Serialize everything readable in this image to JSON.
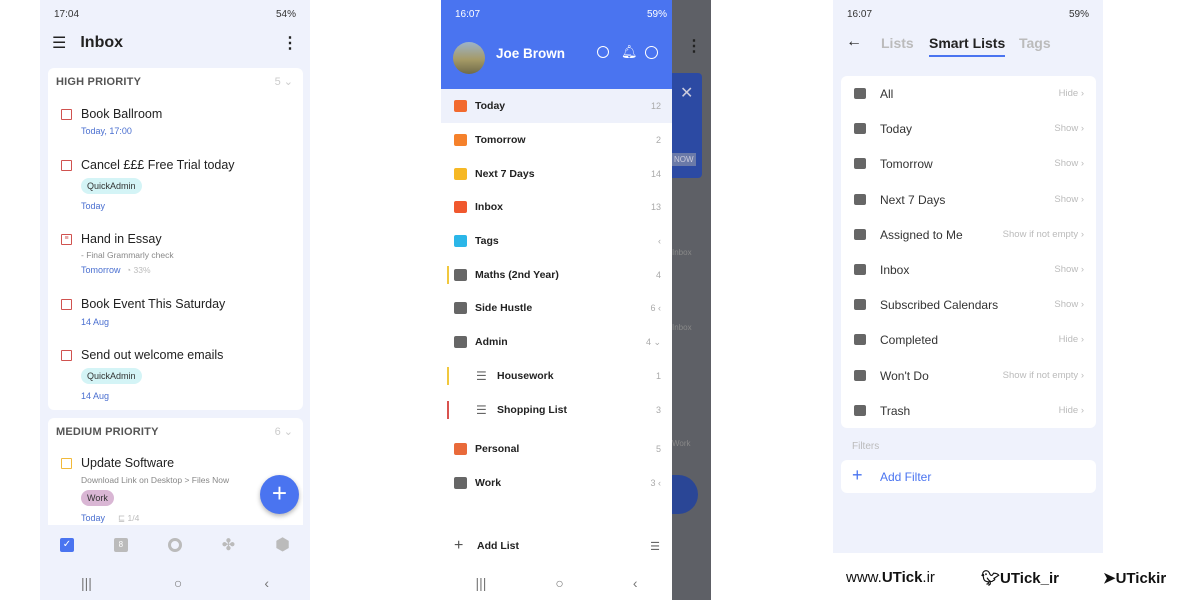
{
  "screen1": {
    "status": {
      "time": "17:04",
      "battery": "54%"
    },
    "title": "Inbox",
    "sections": [
      {
        "name": "HIGH PRIORITY",
        "count": "5",
        "tasks": [
          {
            "title": "Book Ballroom",
            "date": "Today, 17:00"
          },
          {
            "title": "Cancel £££ Free Trial today",
            "tag": "QuickAdmin",
            "date": "Today"
          },
          {
            "title": "Hand in Essay",
            "subtitle": "- Final Grammarly check",
            "date": "Tomorrow",
            "progress": "33%"
          },
          {
            "title": "Book Event This Saturday",
            "date": "14 Aug"
          },
          {
            "title": "Send out welcome emails",
            "tag": "QuickAdmin",
            "date": "14 Aug"
          }
        ]
      },
      {
        "name": "MEDIUM PRIORITY",
        "count": "6",
        "tasks": [
          {
            "title": "Update Software",
            "subtitle": "Download Link on Desktop > Files Now",
            "tag": "Work",
            "date": "Today",
            "subtasks": "1/4"
          }
        ]
      }
    ],
    "fab": "+",
    "nav": [
      "tasks-icon",
      "calendar-icon",
      "search-icon",
      "apps-icon",
      "settings-icon"
    ],
    "calendar_day": "8"
  },
  "screen2": {
    "status": {
      "time": "16:07",
      "battery": "59%"
    },
    "user": "Joe Brown",
    "items": [
      {
        "label": "Today",
        "count": "12",
        "color": "#f26a2e"
      },
      {
        "label": "Tomorrow",
        "count": "2",
        "color": "#f5812b"
      },
      {
        "label": "Next 7 Days",
        "count": "14",
        "color": "#f6b825"
      },
      {
        "label": "Inbox",
        "count": "13",
        "color": "#f0582e"
      },
      {
        "label": "Tags",
        "count": "",
        "color": "#2bb6e8"
      },
      {
        "label": "Maths (2nd Year)",
        "count": "4",
        "color": "#666",
        "bar": "#f1c83d"
      },
      {
        "label": "Side Hustle",
        "count": "6",
        "color": "#666"
      },
      {
        "label": "Admin",
        "count": "4",
        "color": "#666"
      },
      {
        "label": "Housework",
        "count": "1",
        "color": "#666",
        "bar": "#f1c83d",
        "indent": true
      },
      {
        "label": "Shopping List",
        "count": "3",
        "color": "#666",
        "bar": "#d9534f",
        "indent": true
      },
      {
        "label": "Personal",
        "count": "5",
        "color": "#e96a3a"
      },
      {
        "label": "Work",
        "count": "3",
        "color": "#666"
      }
    ],
    "add_list": "Add List",
    "behind": {
      "now": "NOW",
      "inbox": "Inbox",
      "work": "Work"
    }
  },
  "screen3": {
    "status": {
      "time": "16:07",
      "battery": "59%"
    },
    "tabs": [
      "Lists",
      "Smart Lists",
      "Tags"
    ],
    "active_tab": "Smart Lists",
    "rows": [
      {
        "label": "All",
        "value": "Hide"
      },
      {
        "label": "Today",
        "value": "Show"
      },
      {
        "label": "Tomorrow",
        "value": "Show"
      },
      {
        "label": "Next 7 Days",
        "value": "Show"
      },
      {
        "label": "Assigned to Me",
        "value": "Show if not empty"
      },
      {
        "label": "Inbox",
        "value": "Show"
      },
      {
        "label": "Subscribed Calendars",
        "value": "Show"
      },
      {
        "label": "Completed",
        "value": "Hide"
      },
      {
        "label": "Won't Do",
        "value": "Show if not empty"
      },
      {
        "label": "Trash",
        "value": "Hide"
      }
    ],
    "filters_label": "Filters",
    "add_filter": "Add Filter",
    "accent": "#4a74f0"
  },
  "footer": {
    "website_prefix": "www.",
    "website_brand": "UTick",
    "website_suffix": ".ir",
    "twitter": "UTick_ir",
    "telegram": "UTickir"
  }
}
